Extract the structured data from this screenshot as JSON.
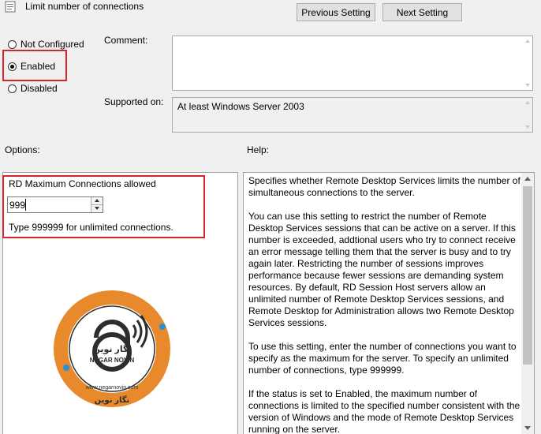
{
  "header": {
    "title": "Limit number of connections",
    "prev_button": "Previous Setting",
    "next_button": "Next Setting"
  },
  "state": {
    "options": [
      {
        "label": "Not Configured",
        "checked": false
      },
      {
        "label": "Enabled",
        "checked": true
      },
      {
        "label": "Disabled",
        "checked": false
      }
    ]
  },
  "comment": {
    "label": "Comment:",
    "value": ""
  },
  "supported": {
    "label": "Supported on:",
    "value": "At least Windows Server 2003"
  },
  "options_section": {
    "label": "Options:",
    "field_label": "RD Maximum Connections allowed",
    "value": "999",
    "hint": "Type 999999 for unlimited connections."
  },
  "help_section": {
    "label": "Help:",
    "paragraphs": [
      "Specifies whether Remote Desktop Services limits the number of simultaneous connections to the server.",
      "You can use this setting to restrict the number of Remote Desktop Services sessions that can be active on a server. If this number is exceeded, addtional users who try to connect receive an error message telling them that the server is busy and to try again later. Restricting the number of sessions improves performance because fewer sessions are demanding system resources. By default, RD Session Host servers allow an unlimited number of Remote Desktop Services sessions, and Remote Desktop for Administration allows two Remote Desktop Services sessions.",
      "To use this setting, enter the number of connections you want to specify as the maximum for the server. To specify an unlimited number of connections, type 999999.",
      "If the status is set to Enabled, the maximum number of connections is limited to the specified number consistent with the version of Windows and the mode of Remote Desktop Services running on the server."
    ]
  },
  "watermark": {
    "brand_fa": "نگار نوین",
    "brand_en": "NEGAR NOVIN",
    "url": "www.negarnovin.com"
  },
  "colors": {
    "highlight_red": "#d9242b",
    "logo_orange": "#e8892b",
    "logo_dark": "#2d2d2d"
  }
}
